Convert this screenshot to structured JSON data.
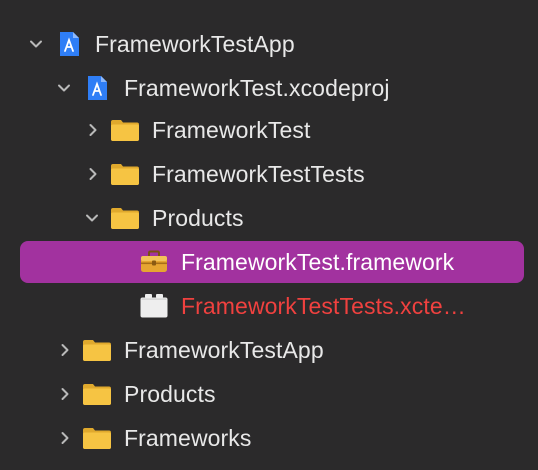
{
  "navigator": {
    "items": [
      {
        "label": "FrameworkTestApp",
        "icon": "project-doc-icon",
        "state": "expanded"
      },
      {
        "label": "FrameworkTest.xcodeproj",
        "icon": "xcodeproj-icon",
        "state": "expanded"
      },
      {
        "label": "FrameworkTest",
        "icon": "folder-icon",
        "state": "collapsed"
      },
      {
        "label": "FrameworkTestTests",
        "icon": "folder-icon",
        "state": "collapsed"
      },
      {
        "label": "Products",
        "icon": "folder-icon",
        "state": "expanded"
      },
      {
        "label": "FrameworkTest.framework",
        "icon": "framework-toolbox-icon",
        "state": "selected"
      },
      {
        "label": "FrameworkTestTests.xcte…",
        "icon": "xctest-bundle-icon",
        "state": "missing"
      },
      {
        "label": "FrameworkTestApp",
        "icon": "folder-icon",
        "state": "collapsed"
      },
      {
        "label": "Products",
        "icon": "folder-icon",
        "state": "collapsed"
      },
      {
        "label": "Frameworks",
        "icon": "folder-icon",
        "state": "collapsed"
      }
    ]
  },
  "colors": {
    "background": "#2b2a2b",
    "selection": "#a2329f",
    "missing_text": "#f0413f",
    "folder": "#f5c542",
    "project_icon": "#2f7ef6"
  }
}
